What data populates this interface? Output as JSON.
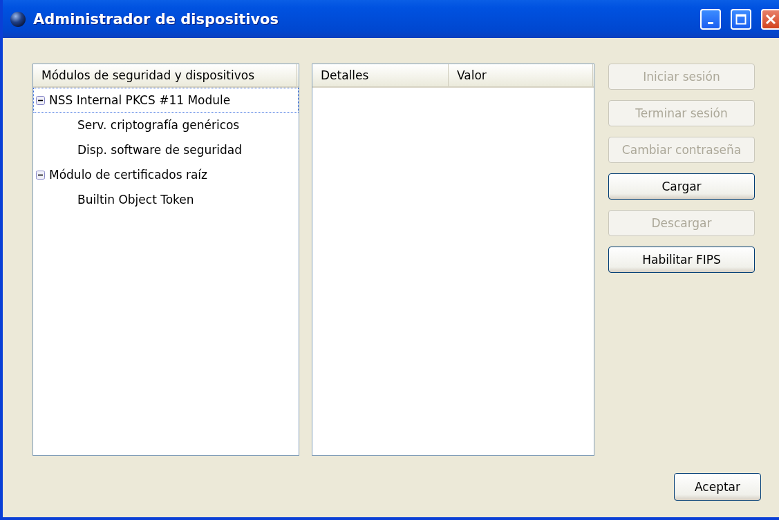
{
  "window": {
    "title": "Administrador de dispositivos"
  },
  "tree": {
    "column": "Módulos de seguridad y dispositivos",
    "items": [
      {
        "label": "NSS Internal PKCS #11 Module",
        "expanded": true,
        "selected": true,
        "children": [
          {
            "label": "Serv. criptografía genéricos",
            "selected": false
          },
          {
            "label": "Disp. software de seguridad",
            "selected": false
          }
        ]
      },
      {
        "label": "Módulo de certificados raíz",
        "expanded": true,
        "selected": false,
        "children": [
          {
            "label": "Builtin Object Token",
            "selected": false
          }
        ]
      }
    ]
  },
  "details": {
    "columns": [
      "Detalles",
      "Valor"
    ]
  },
  "buttons": [
    {
      "label": "Iniciar sesión",
      "disabled": true
    },
    {
      "label": "Terminar sesión",
      "disabled": true
    },
    {
      "label": "Cambiar contraseña",
      "disabled": true
    },
    {
      "label": "Cargar",
      "disabled": false
    },
    {
      "label": "Descargar",
      "disabled": true
    },
    {
      "label": "Habilitar FIPS",
      "disabled": false
    }
  ],
  "ok_button": "Aceptar"
}
